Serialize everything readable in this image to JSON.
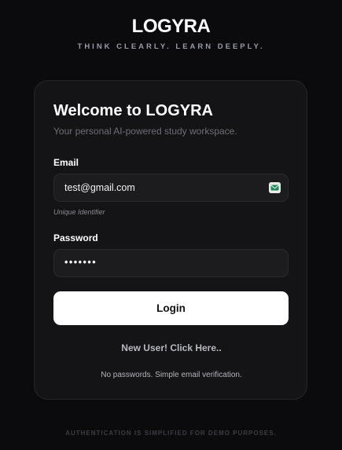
{
  "brand": {
    "name": "LOGYRA",
    "tagline": "THINK CLEARLY. LEARN DEEPLY."
  },
  "card": {
    "title": "Welcome to LOGYRA",
    "subtitle": "Your personal AI-powered study workspace."
  },
  "email": {
    "label": "Email",
    "value": "test@gmail.com",
    "hint": "Unique Identifier",
    "icon": "mail-icon"
  },
  "password": {
    "label": "Password",
    "value": "•••••••"
  },
  "actions": {
    "login_label": "Login",
    "new_user_label": "New User! Click Here.."
  },
  "note": "No passwords. Simple email verification.",
  "footer": "AUTHENTICATION IS SIMPLIFIED FOR DEMO PURPOSES.",
  "colors": {
    "background": "#0b0b0d",
    "card": "#141416",
    "input": "#1c1c1f",
    "button": "#ffffff",
    "icon_accent": "#1f8a5a"
  }
}
